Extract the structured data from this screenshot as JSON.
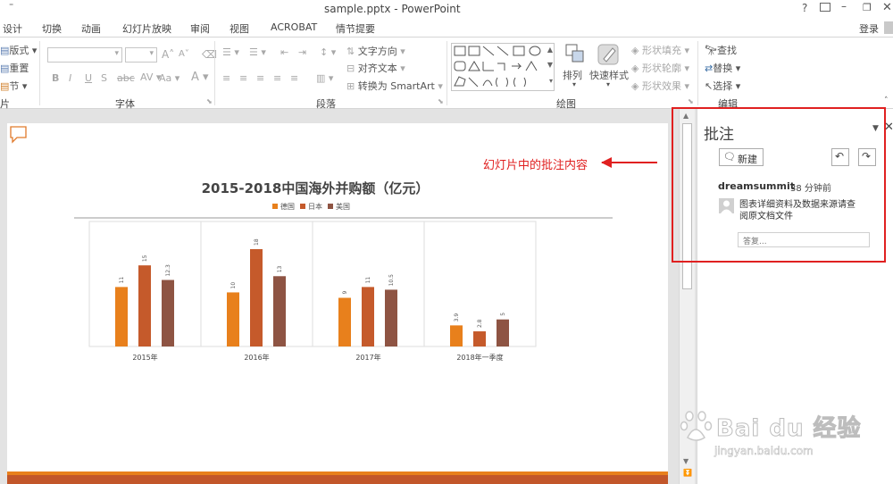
{
  "window": {
    "title": "sample.pptx - PowerPoint",
    "help": "?",
    "signin": "登录"
  },
  "tabs": [
    "设计",
    "切换",
    "动画",
    "幻灯片放映",
    "审阅",
    "视图",
    "ACROBAT",
    "情节提要"
  ],
  "ribbon": {
    "slides_group": {
      "layout": "版式",
      "reset": "重置",
      "section": "节",
      "label": "片"
    },
    "font_group": {
      "label": "字体"
    },
    "paragraph_group": {
      "text_direction": "文字方向",
      "align_text": "对齐文本",
      "smartart": "转换为 SmartArt",
      "label": "段落"
    },
    "drawing_group": {
      "arrange": "排列",
      "quick_styles": "快速样式",
      "shape_fill": "形状填充",
      "shape_outline": "形状轮廓",
      "shape_effects": "形状效果",
      "label": "绘图"
    },
    "editing_group": {
      "find": "查找",
      "replace": "替换",
      "select": "选择",
      "label": "编辑"
    }
  },
  "slide": {
    "annotation": "幻灯片中的批注内容",
    "chart_data": {
      "type": "bar",
      "title": "2015-2018中国海外并购额（亿元）",
      "categories": [
        "2015年",
        "2016年",
        "2017年",
        "2018年一季度"
      ],
      "series": [
        {
          "name": "德国",
          "values": [
            11,
            10,
            9,
            3.9
          ],
          "color": "#e8801c"
        },
        {
          "name": "日本",
          "values": [
            15,
            18,
            11,
            2.8
          ],
          "color": "#c55a2b"
        },
        {
          "name": "美国",
          "values": [
            12.3,
            13,
            10.5,
            5
          ],
          "color": "#8e5443"
        }
      ],
      "ylim": [
        0,
        20
      ],
      "grid": false,
      "legend": "top"
    }
  },
  "comments_pane": {
    "title": "批注",
    "new_button": "新建",
    "author": "dreamsummit",
    "time": "38 分钟前",
    "text_line1": "图表详细资料及数据来源请查",
    "text_line2": "阅原文档文件",
    "reply_placeholder": "答复...",
    "accent": "#c0392b"
  },
  "watermark": {
    "brand": "Bai du 经验",
    "url": "jingyan.baidu.com"
  }
}
